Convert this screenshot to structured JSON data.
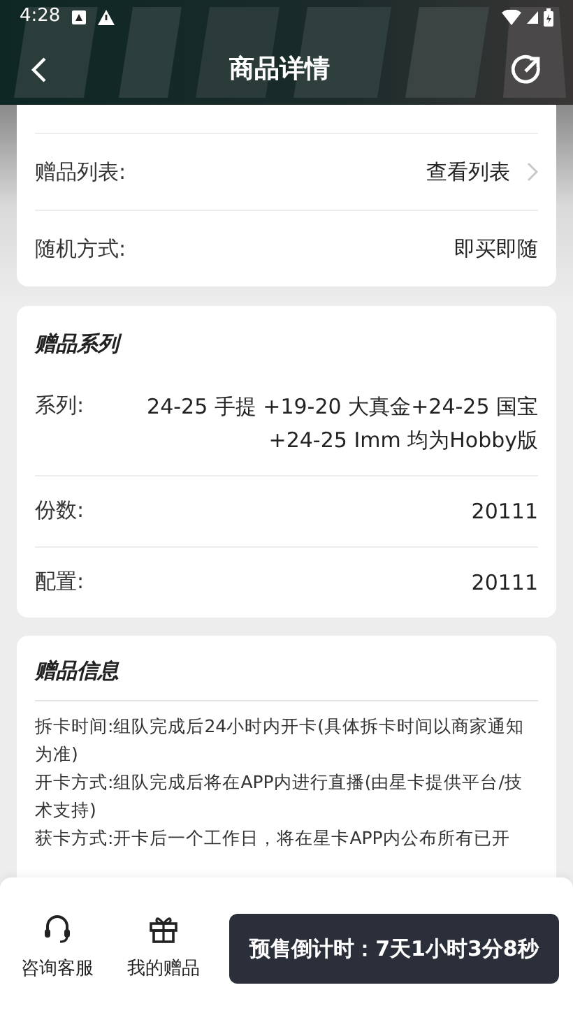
{
  "status_bar": {
    "time": "4:28"
  },
  "header": {
    "title": "商品详情"
  },
  "basic_rows": [
    {
      "label": "赠品列表:",
      "value": "查看列表",
      "kind": "link"
    },
    {
      "label": "随机方式:",
      "value": "即买即随",
      "kind": "plain"
    }
  ],
  "series_card": {
    "title": "赠品系列",
    "rows": [
      {
        "label": "系列:",
        "value": "24-25 手提 +19-20 大真金+24-25 国宝+24-25 Imm 均为Hobby版"
      },
      {
        "label": "份数:",
        "value": "20111"
      },
      {
        "label": "配置:",
        "value": "20111"
      }
    ]
  },
  "info_card": {
    "title": "赠品信息",
    "paragraphs": [
      "拆卡时间:组队完成后24小时内开卡(具体拆卡时间以商家通知为准)",
      "开卡方式:组队完成后将在APP内进行直播(由星卡提供平台/技术支持)",
      "获卡方式:开卡后一个工作日，将在星卡APP内公布所有已开"
    ]
  },
  "bottom_bar": {
    "actions": [
      {
        "label": "咨询客服",
        "kind": "headset"
      },
      {
        "label": "我的赠品",
        "kind": "gift"
      }
    ],
    "countdown": "预售倒计时：7天1小时3分8秒"
  }
}
